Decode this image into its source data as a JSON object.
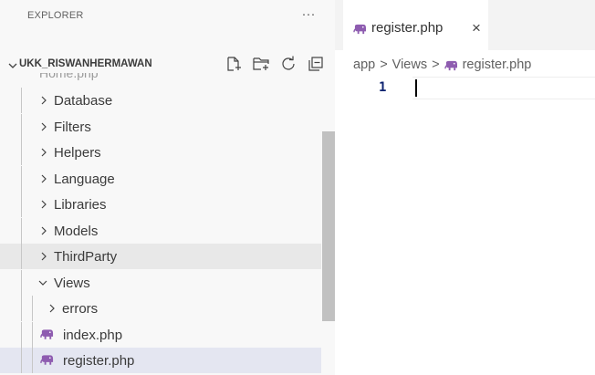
{
  "sidebar": {
    "title": "EXPLORER",
    "more_icon": "ellipsis-icon",
    "folder_name": "UKK_RISWANHERMAWAN",
    "actions": [
      "new-file-icon",
      "new-folder-icon",
      "refresh-icon",
      "collapse-all-icon"
    ],
    "peek_item": "Home.php",
    "items": [
      {
        "label": "Database",
        "type": "folder",
        "expanded": false
      },
      {
        "label": "Filters",
        "type": "folder",
        "expanded": false
      },
      {
        "label": "Helpers",
        "type": "folder",
        "expanded": false
      },
      {
        "label": "Language",
        "type": "folder",
        "expanded": false
      },
      {
        "label": "Libraries",
        "type": "folder",
        "expanded": false
      },
      {
        "label": "Models",
        "type": "folder",
        "expanded": false
      },
      {
        "label": "ThirdParty",
        "type": "folder",
        "expanded": false
      },
      {
        "label": "Views",
        "type": "folder",
        "expanded": true
      },
      {
        "label": "errors",
        "type": "folder",
        "expanded": false
      },
      {
        "label": "index.php",
        "type": "file",
        "icon": "php-elephant-icon"
      },
      {
        "label": "register.php",
        "type": "file",
        "icon": "php-elephant-icon"
      }
    ]
  },
  "editor": {
    "tab": {
      "label": "register.php",
      "close": "×",
      "icon": "php-elephant-icon"
    },
    "breadcrumb": [
      "app",
      "Views",
      "register.php"
    ],
    "breadcrumb_sep": ">",
    "line_numbers": [
      "1"
    ]
  },
  "colors": {
    "php_icon": "#8e5cb0",
    "sidebar_bg": "#f8f8f8",
    "selected_row": "#e4e6f1",
    "hover_row": "#e8e8e8",
    "line_number": "#0b216f"
  }
}
